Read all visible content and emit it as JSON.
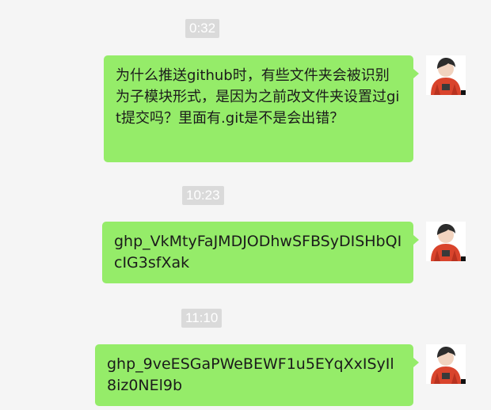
{
  "chat": {
    "messages": [
      {
        "time": "0:32",
        "text": "为什么推送github时，有些文件夹会被识别为子模块形式，是因为之前改文件夹设置过git提交吗？里面有.git是不是会出错？"
      },
      {
        "time": "10:23",
        "text": "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"
      },
      {
        "time": "11:10",
        "text": "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"
      }
    ]
  },
  "colors": {
    "background": "#f5f5f5",
    "bubble": "#95ec69",
    "time_badge": "#dadada",
    "avatar_coat": "#d9442c"
  },
  "icons": {
    "avatar": "user-avatar-red-coat-icon"
  }
}
